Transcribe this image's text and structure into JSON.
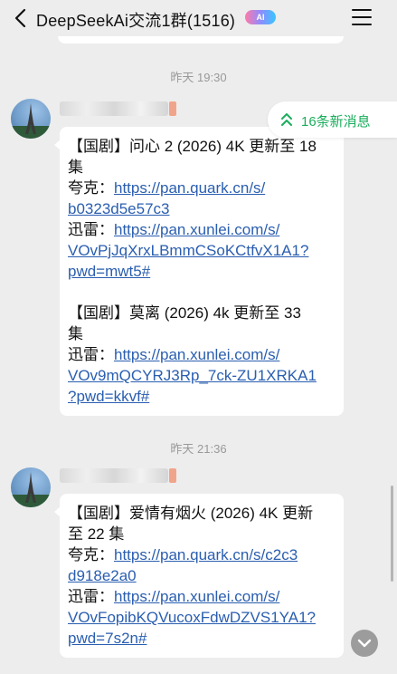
{
  "header": {
    "title": "DeepSeekAi交流1群(1516)",
    "ai_badge": "AI",
    "back_icon": "chevron-left-icon",
    "menu_icon": "hamburger-menu-icon"
  },
  "new_messages_pill": {
    "label": "16条新消息",
    "icon": "double-chevron-up-icon",
    "accent": "#1aad5c"
  },
  "messages": [
    {
      "timestamp": "昨天 19:30",
      "lines": [
        {
          "type": "text",
          "value": "【国剧】问心 2 (2026) 4K 更新至 18"
        },
        {
          "type": "text",
          "value": "集"
        },
        {
          "type": "mixed",
          "label": "夸克：",
          "link": "https://pan.quark.cn/s/"
        },
        {
          "type": "link",
          "value": "b0323d5e57c3"
        },
        {
          "type": "mixed",
          "label": "迅雷：",
          "link": "https://pan.xunlei.com/s/"
        },
        {
          "type": "link",
          "value": "VOvPjJqXrxLBmmCSoKCtfvX1A1?"
        },
        {
          "type": "link",
          "value": "pwd=mwt5#"
        },
        {
          "type": "blank"
        },
        {
          "type": "text",
          "value": "【国剧】莫离 (2026) 4k 更新至 33"
        },
        {
          "type": "text",
          "value": "集"
        },
        {
          "type": "mixed",
          "label": "迅雷：",
          "link": "https://pan.xunlei.com/s/"
        },
        {
          "type": "link",
          "value": "VOv9mQCYRJ3Rp_7ck-ZU1XRKA1"
        },
        {
          "type": "link",
          "value": "?pwd=kkvf#"
        }
      ]
    },
    {
      "timestamp": "昨天 21:36",
      "lines": [
        {
          "type": "text",
          "value": "【国剧】爱情有烟火 (2026) 4K 更新"
        },
        {
          "type": "text",
          "value": "至 22 集"
        },
        {
          "type": "mixed",
          "label": "夸克：",
          "link": "https://pan.quark.cn/s/c2c3"
        },
        {
          "type": "link",
          "value": "d918e2a0"
        },
        {
          "type": "mixed",
          "label": "迅雷：",
          "link": "https://pan.xunlei.com/s/"
        },
        {
          "type": "link",
          "value": "VOvFopibKQVucoxFdwDZVS1YA1?"
        },
        {
          "type": "link",
          "value": "pwd=7s2n#"
        }
      ]
    }
  ],
  "colors": {
    "background": "#ededed",
    "bubble": "#ffffff",
    "link": "#2a5eb0",
    "timestamp": "#999999"
  }
}
